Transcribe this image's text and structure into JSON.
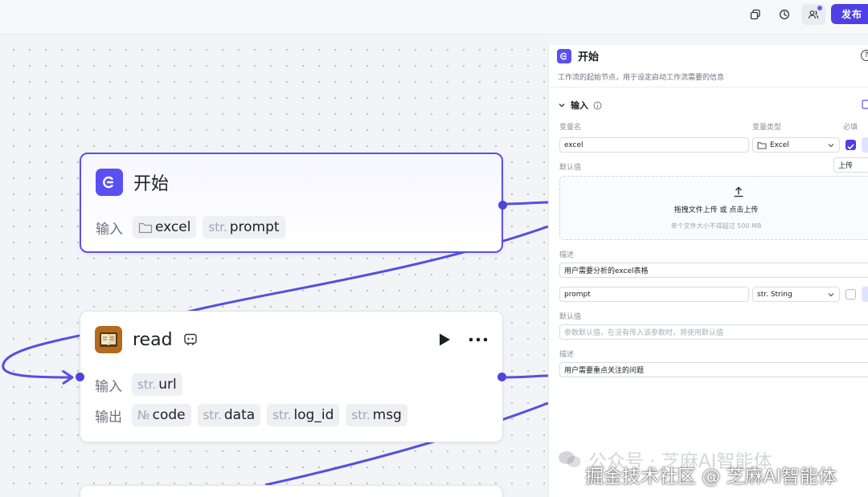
{
  "topbar": {
    "publish_label": "发布"
  },
  "nodes": {
    "start": {
      "title": "开始",
      "input_label": "输入",
      "inputs": [
        {
          "prefix": "",
          "name": "excel"
        },
        {
          "prefix": "str.",
          "name": "prompt"
        }
      ]
    },
    "read": {
      "title": "read",
      "input_label": "输入",
      "output_label": "输出",
      "inputs": [
        {
          "prefix": "str.",
          "name": "url"
        }
      ],
      "outputs": [
        {
          "prefix": "№",
          "name": "code"
        },
        {
          "prefix": "str.",
          "name": "data"
        },
        {
          "prefix": "str.",
          "name": "log_id"
        },
        {
          "prefix": "str.",
          "name": "msg"
        }
      ]
    }
  },
  "panel": {
    "title": "开始",
    "help": "?",
    "description": "工作流的起始节点，用于设定启动工作流需要的信息",
    "section_title": "输入",
    "col_var_name": "变量名",
    "col_var_type": "变量类型",
    "col_required": "必填",
    "var1": {
      "name": "excel",
      "type": "Excel",
      "default_label": "默认值",
      "default_mode": "上传",
      "upload_main": "拖拽文件上传 或 点击上传",
      "upload_sub": "单个文件大小不得超过 500 MB",
      "desc_label": "描述",
      "desc_value": "用户需要分析的excel表格",
      "required": true
    },
    "var2": {
      "name": "prompt",
      "type": "str. String",
      "default_label": "默认值",
      "default_placeholder": "参数默认值，在没有传入该参数时，将使用默认值",
      "desc_label": "描述",
      "desc_value": "用户需要重点关注的问题",
      "required": false
    }
  },
  "watermarks": {
    "wechat": "公众号 · 芝麻AI智能体",
    "juejin": "掘金技术社区 @ 芝麻AI智能体"
  }
}
